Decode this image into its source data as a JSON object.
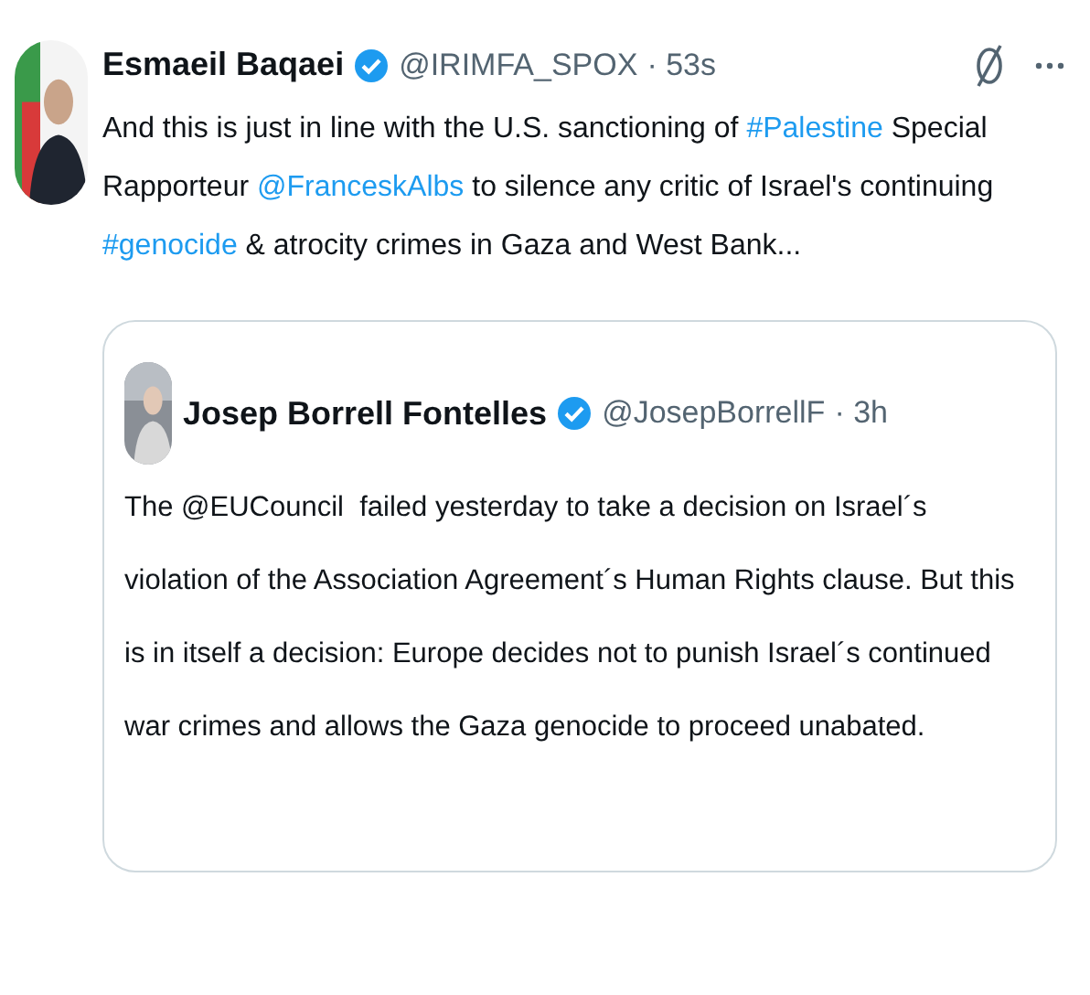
{
  "tweet": {
    "name": "Esmaeil Baqaei",
    "verified": true,
    "handle": "@IRIMFA_SPOX",
    "time": "· 53s",
    "text": [
      {
        "kind": "text",
        "text": "And this is just in line with the U.S. sanctioning of "
      },
      {
        "kind": "hashtag",
        "text": "#Palestine"
      },
      {
        "kind": "text",
        "text": " Special Rapporteur "
      },
      {
        "kind": "mention",
        "text": "@FranceskAlbs"
      },
      {
        "kind": "text",
        "text": " to silence any critic of Israel's continuing "
      },
      {
        "kind": "hashtag",
        "text": "#genocide"
      },
      {
        "kind": "text",
        "text": " & atrocity crimes in Gaza and West Bank..."
      }
    ]
  },
  "quoted_tweet": {
    "name": "Josep Borrell Fontelles",
    "verified": true,
    "handle": "@JosepBorrellF",
    "time": "· 3h",
    "text": "The @EUCouncil  failed yesterday to take a decision on Israel´s violation of the Association Agreement´s Human Rights clause. But this is in itself a decision: Europe decides not to punish Israel´s continued war crimes and allows the Gaza genocide to proceed unabated."
  }
}
